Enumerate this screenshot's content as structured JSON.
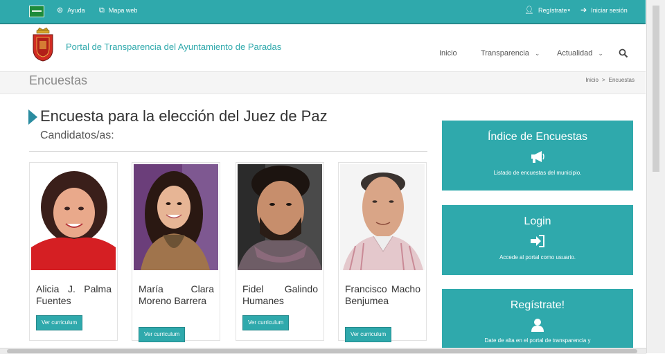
{
  "topbar": {
    "help_label": "Ayuda",
    "sitemap_label": "Mapa web",
    "register_label": "Regístrate",
    "login_label": "Iniciar sesión"
  },
  "header": {
    "site_title": "Portal de Transparencia del Ayuntamiento de Paradas",
    "nav": [
      "Inicio",
      "Transparencia",
      "Actualidad"
    ]
  },
  "page": {
    "title": "Encuestas",
    "breadcrumb": [
      "Inicio",
      ">",
      "Encuestas"
    ]
  },
  "poll": {
    "title": "Encuesta para la elección del Juez de Paz",
    "subtitle": "Candidatos/as:",
    "cv_label": "Ver curriculum",
    "candidates": [
      {
        "name": "Alicia J. Palma Fuentes"
      },
      {
        "name": "María Clara Moreno Barrera"
      },
      {
        "name": "Fidel Galindo Humanes"
      },
      {
        "name": "Francisco Macho Benjumea"
      }
    ]
  },
  "sidebar": {
    "cards": [
      {
        "title": "Índice de Encuestas",
        "desc": "Listado de encuestas del municipio.",
        "icon": "megaphone-icon"
      },
      {
        "title": "Login",
        "desc": "Accede al portal como usuario.",
        "icon": "sign-in-icon"
      },
      {
        "title": "Regístrate!",
        "desc": "Date de alta en el portal de transparencia y",
        "icon": "user-icon"
      }
    ]
  },
  "colors": {
    "accent": "#2fa9ac",
    "accent_dark": "#258a8d"
  }
}
